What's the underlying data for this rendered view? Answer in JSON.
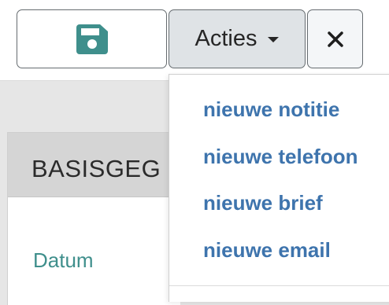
{
  "toolbar": {
    "save_icon": "floppy-disk-icon",
    "actions_label": "Acties",
    "actions_caret_icon": "caret-down-icon",
    "close_icon": "close-icon",
    "close_glyph": "✕"
  },
  "panel": {
    "title": "BASISGEG",
    "field_label": "Datum"
  },
  "dropdown": {
    "items": [
      {
        "label": "nieuwe notitie"
      },
      {
        "label": "nieuwe telefoon"
      },
      {
        "label": "nieuwe brief"
      },
      {
        "label": "nieuwe email"
      }
    ]
  },
  "colors": {
    "save_icon": "#3f8f8c",
    "menu_link": "#3e74ad",
    "field_label": "#3f8f8c",
    "actions_bg": "#dfe3e6"
  }
}
